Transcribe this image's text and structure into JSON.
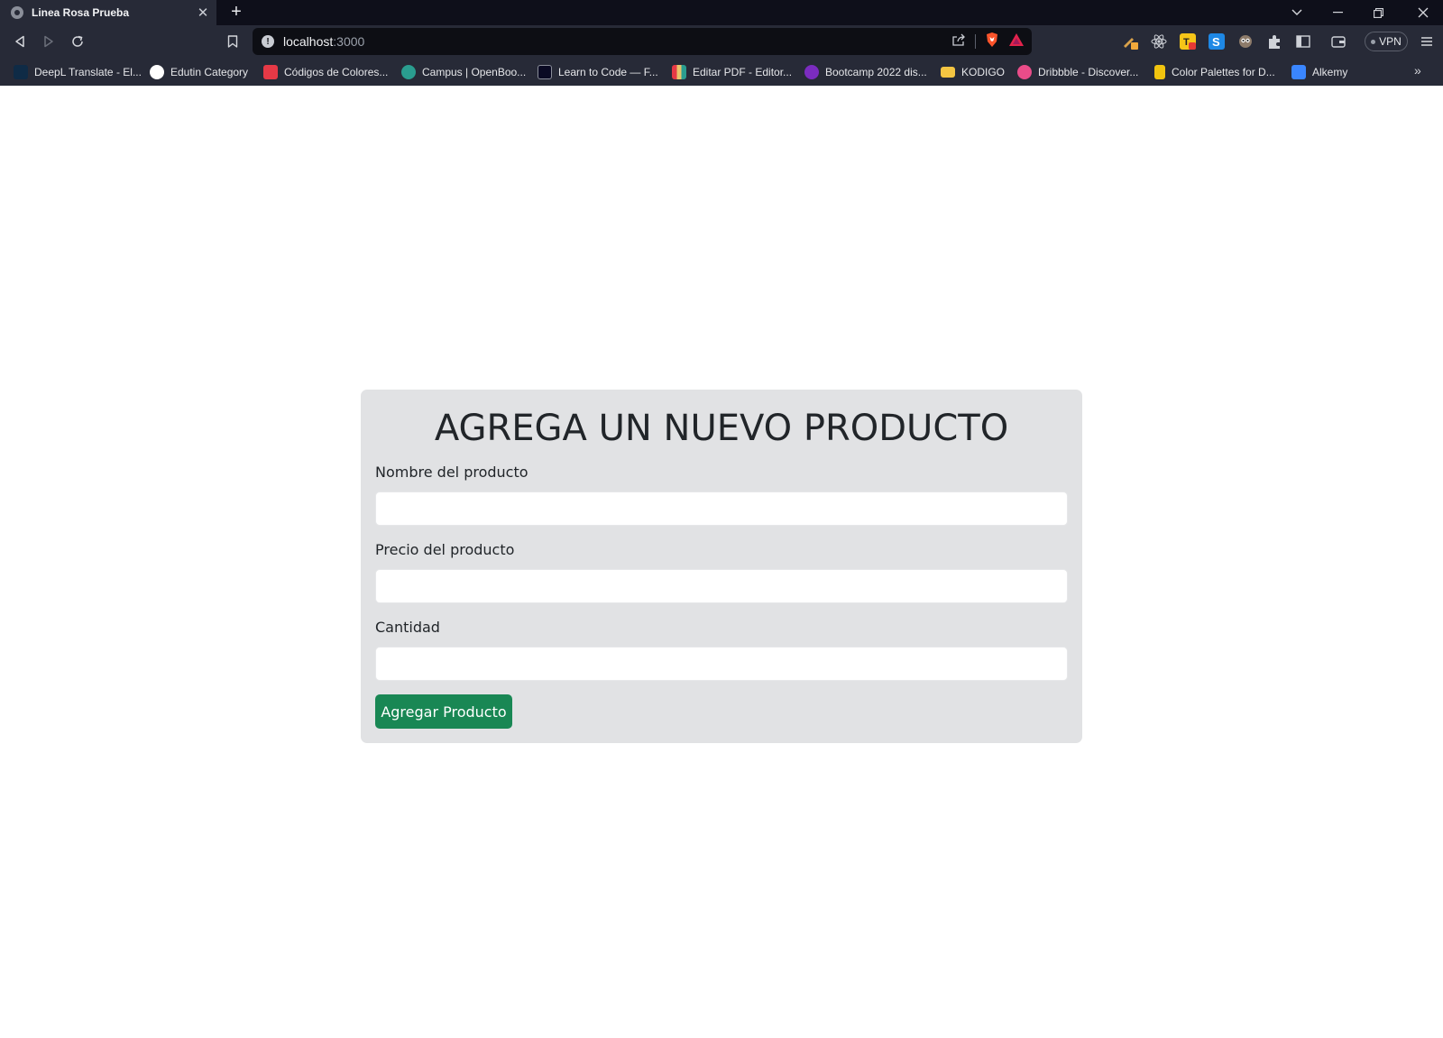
{
  "browser": {
    "tab": {
      "title": "Linea Rosa Prueba",
      "favicon_icon": "globe-icon",
      "close_label": "✕"
    },
    "new_tab_label": "+",
    "window_controls": {
      "dropdown": "⌄",
      "minimize": "—",
      "restore": "❐",
      "close": "✕"
    },
    "address": {
      "host": "localhost",
      "port": ":3000"
    },
    "vpn_label": "VPN",
    "bookmarks": [
      {
        "label": "DeepL Translate - El...",
        "color": "#0f2b46"
      },
      {
        "label": "Edutin Category",
        "color": "#ffffff"
      },
      {
        "label": "Códigos de Colores...",
        "color": "#e63946"
      },
      {
        "label": "Campus | OpenBoo...",
        "color": "#2a9d8f"
      },
      {
        "label": "Learn to Code — F...",
        "color": "#0a0a23"
      },
      {
        "label": "Editar PDF - Editor...",
        "color": "#e9c46a"
      },
      {
        "label": "Bootcamp 2022 dis...",
        "color": "#7b2cbf"
      },
      {
        "label": "KODIGO",
        "color": "#f4c542"
      },
      {
        "label": "Dribbble - Discover...",
        "color": "#ea4c89"
      },
      {
        "label": "Color Palettes for D...",
        "color": "#f1c40f"
      },
      {
        "label": "Alkemy",
        "color": "#3a86ff"
      }
    ]
  },
  "form": {
    "title": "AGREGA UN NUEVO PRODUCTO",
    "fields": [
      {
        "label": "Nombre del producto",
        "value": ""
      },
      {
        "label": "Precio del producto",
        "value": ""
      },
      {
        "label": "Cantidad",
        "value": ""
      }
    ],
    "submit_label": "Agregar Producto",
    "accent_color": "#198754"
  }
}
